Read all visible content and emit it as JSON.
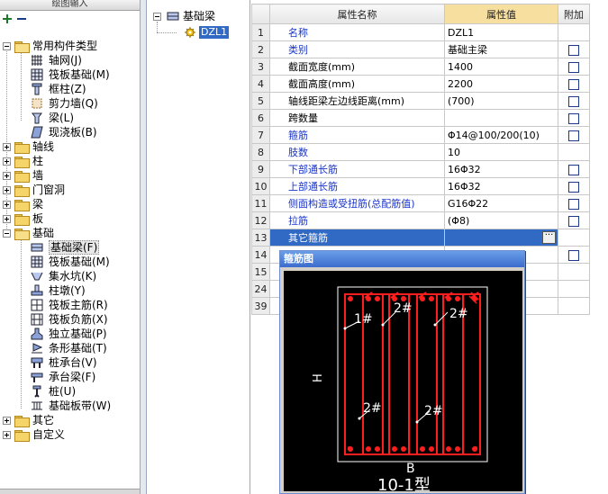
{
  "left_panel": {
    "header": "绘图输入",
    "tree": {
      "common_types": {
        "label": "常用构件类型",
        "items": [
          "轴网(J)",
          "筏板基础(M)",
          "框柱(Z)",
          "剪力墙(Q)",
          "梁(L)",
          "现浇板(B)"
        ]
      },
      "groups_a": [
        "轴线",
        "柱",
        "墙",
        "门窗洞",
        "梁",
        "板"
      ],
      "foundation": {
        "label": "基础",
        "items": [
          "基础梁(F)",
          "筏板基础(M)",
          "集水坑(K)",
          "柱墩(Y)",
          "筏板主筋(R)",
          "筏板负筋(X)",
          "独立基础(P)",
          "条形基础(T)",
          "桩承台(V)",
          "承台梁(F)",
          "桩(U)",
          "基础板带(W)"
        ],
        "selected": "基础梁(F)"
      },
      "groups_b": [
        "其它",
        "自定义"
      ]
    }
  },
  "mid_panel": {
    "root": "基础梁",
    "child": "DZL1"
  },
  "grid": {
    "headers": {
      "name": "属性名称",
      "value": "属性值",
      "extra": "附加"
    },
    "rows": [
      {
        "n": "1",
        "name": "名称",
        "value": "DZL1",
        "blue": true,
        "check": false
      },
      {
        "n": "2",
        "name": "类别",
        "value": "基础主梁",
        "blue": true,
        "check": true
      },
      {
        "n": "3",
        "name": "截面宽度(mm)",
        "value": "1400",
        "blue": false,
        "check": true
      },
      {
        "n": "4",
        "name": "截面高度(mm)",
        "value": "2200",
        "blue": false,
        "check": true
      },
      {
        "n": "5",
        "name": "轴线距梁左边线距离(mm)",
        "value": "(700)",
        "blue": false,
        "check": true
      },
      {
        "n": "6",
        "name": "跨数量",
        "value": "",
        "blue": false,
        "check": true
      },
      {
        "n": "7",
        "name": "箍筋",
        "value": "Φ14@100/200(10)",
        "blue": true,
        "check": true
      },
      {
        "n": "8",
        "name": "肢数",
        "value": "10",
        "blue": true,
        "check": false
      },
      {
        "n": "9",
        "name": "下部通长筋",
        "value": "16Φ32",
        "blue": true,
        "check": true
      },
      {
        "n": "10",
        "name": "上部通长筋",
        "value": "16Φ32",
        "blue": true,
        "check": true
      },
      {
        "n": "11",
        "name": "侧面构造或受扭筋(总配筋值)",
        "value": "G16Φ22",
        "blue": true,
        "check": true
      },
      {
        "n": "12",
        "name": "拉筋",
        "value": "(Φ8)",
        "blue": true,
        "check": true
      },
      {
        "n": "13",
        "name": "其它箍筋",
        "value": "",
        "blue": false,
        "check": false,
        "current": true
      },
      {
        "n": "14",
        "name": "",
        "value": "",
        "blue": false,
        "check": true
      },
      {
        "n": "15",
        "name": "",
        "value": "",
        "blue": false,
        "check": false
      },
      {
        "n": "24",
        "name": "",
        "value": "",
        "blue": false,
        "check": false
      },
      {
        "n": "39",
        "name": "",
        "value": "",
        "blue": false,
        "check": false
      }
    ],
    "ellipsis": "···"
  },
  "popup": {
    "title": "箍筋图",
    "label_h": "H",
    "label_b": "B",
    "label_1": "1#",
    "label_2": "2#",
    "type_label": "10-1型"
  },
  "colors": {
    "selection": "#316ac5",
    "rebar": "#ff1e1e",
    "label_blue": "#1a35c8"
  }
}
